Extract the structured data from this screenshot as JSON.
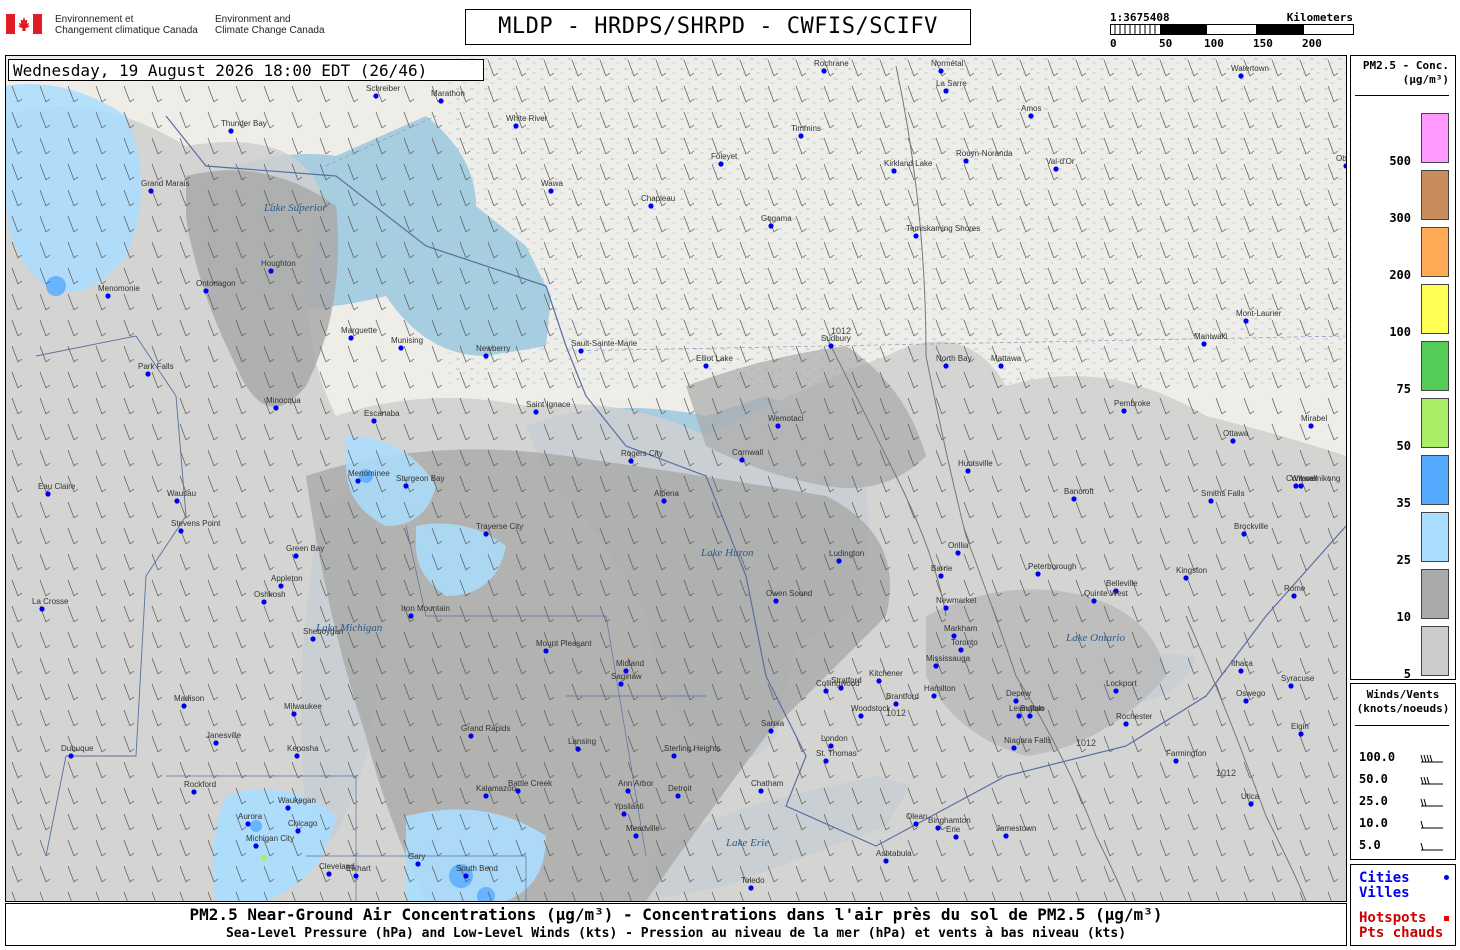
{
  "header": {
    "dept_fr": [
      "Environnement et",
      "Changement climatique Canada"
    ],
    "dept_en": [
      "Environment and",
      "Climate Change Canada"
    ],
    "title": "MLDP - HRDPS/SHRPD - CWFIS/SCIFV",
    "scale": {
      "ratio": "1:3675408",
      "unit": "Kilometers",
      "ticks": [
        "0",
        "50",
        "100",
        "150",
        "200"
      ]
    }
  },
  "map": {
    "datetime": "Wednesday, 19 August 2026 18:00 EDT (26/46)",
    "cities": [
      "Thunder Bay",
      "Grand Marais",
      "Houghton",
      "Ontonagon",
      "Marquette",
      "Munising",
      "Newberry",
      "Sault-Sainte-Marie",
      "Elliot Lake",
      "Wawa",
      "White River",
      "Marathon",
      "Schreiber",
      "Chapleau",
      "Foleyet",
      "Timmins",
      "Gogama",
      "Kirkland Lake",
      "Rouyn-Noranda",
      "Temiskaming Shores",
      "Val-d'Or",
      "La Sarre",
      "Normétal",
      "Amos",
      "Rochrane",
      "Sudbury",
      "North Bay",
      "Mattawa",
      "Pembroke",
      "Ottawa",
      "Maniwaki",
      "Mont-Laurier",
      "Mirabel",
      "Cornwall",
      "Brockville",
      "Smiths Falls",
      "Kingston",
      "Belleville",
      "Quinte West",
      "Peterborough",
      "Bancroft",
      "Huntsville",
      "Orillia",
      "Barrie",
      "Newmarket",
      "Markham",
      "Toronto",
      "Mississauga",
      "Hamilton",
      "Kitchener",
      "Brantford",
      "Woodstock",
      "Stratford",
      "London",
      "St. Thomas",
      "Chatham",
      "Detroit",
      "Ann Arbor",
      "Ypsilanti",
      "Lansing",
      "Grand Rapids",
      "Kalamazoo",
      "Battle Creek",
      "Sterling Heights",
      "Midland",
      "Saginaw",
      "Mount Pleasant",
      "Traverse City",
      "Alpena",
      "Rogers City",
      "Saint Ignace",
      "Escanaba",
      "Menominee",
      "Sturgeon Bay",
      "Green Bay",
      "Appleton",
      "Oshkosh",
      "Sheboygan",
      "Milwaukee",
      "Kenosha",
      "Waukegan",
      "Chicago",
      "Rockford",
      "Janesville",
      "Madison",
      "Dubuque",
      "La Crosse",
      "Eau Claire",
      "Wausau",
      "Stevens Point",
      "Menomonie",
      "Park Falls",
      "Minocqua",
      "Iron Mountain",
      "Ludington",
      "Owen Sound",
      "Collingwood",
      "Sarnia",
      "Lexington",
      "Niagara Falls",
      "Buffalo",
      "Depew",
      "Lockport",
      "Rochester",
      "Farmington",
      "Ithaca",
      "Oswego",
      "Syracuse",
      "Utica",
      "Binghamton",
      "Erie",
      "Jamestown",
      "Olean",
      "Ashtabula",
      "Meadville",
      "Toledo",
      "Cleveland",
      "Gary",
      "South Bend",
      "Elkhart",
      "Michigan City",
      "Aurora",
      "Elgin",
      "Rome",
      "Watertown",
      "Obedjiwan",
      "Wemotaci",
      "Wikwemikong",
      "Cornwall"
    ],
    "lakes": [
      "Lake Superior",
      "Lake Michigan",
      "Lake Huron",
      "Lake Ontario",
      "Lake Erie"
    ],
    "isobar_label": "1012"
  },
  "legend_pm": {
    "title": [
      "PM2.5 - Conc.",
      "(μg/m³)"
    ],
    "bins": [
      {
        "label": "500",
        "color": "#ff99ff"
      },
      {
        "label": "300",
        "color": "#c68c5a"
      },
      {
        "label": "200",
        "color": "#ffaa55"
      },
      {
        "label": "100",
        "color": "#ffff55"
      },
      {
        "label": "75",
        "color": "#55cc55"
      },
      {
        "label": "50",
        "color": "#aaee66"
      },
      {
        "label": "35",
        "color": "#55aaff"
      },
      {
        "label": "25",
        "color": "#aaddff"
      },
      {
        "label": "10",
        "color": "#aaaaaa"
      },
      {
        "label": "5",
        "color": "#cccccc"
      }
    ]
  },
  "legend_wind": {
    "title": [
      "Winds/Vents",
      "(knots/noeuds)"
    ],
    "values": [
      "100.0",
      "50.0",
      "25.0",
      "10.0",
      "5.0"
    ]
  },
  "legend_points": {
    "cities": [
      "Cities",
      "Villes"
    ],
    "hotspots": [
      "Hotspots",
      "Pts chauds"
    ],
    "city_color": "#0000ee",
    "hotspot_color": "#ee0000"
  },
  "captions": {
    "line1": "PM2.5 Near-Ground Air Concentrations (μg/m³) - Concentrations dans l'air près du sol de PM2.5 (μg/m³)",
    "line2": "Sea-Level Pressure (hPa) and Low-Level Winds (kts) - Pression au niveau de la mer (hPa) et vents à bas niveau (kts)"
  }
}
